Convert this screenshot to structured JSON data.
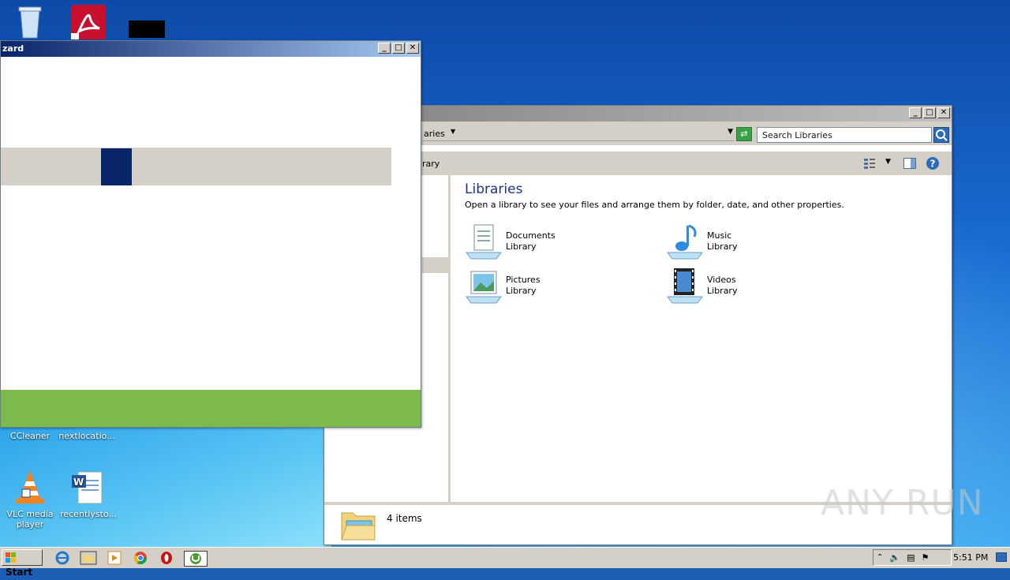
{
  "desktop": {
    "icons": [
      {
        "label": "",
        "icon": "recycle-bin-icon"
      },
      {
        "label": "",
        "icon": "acrobat-reader-icon"
      },
      {
        "label": "",
        "icon": "black-app-icon"
      },
      {
        "label": "CCleaner",
        "icon": "ccleaner-icon"
      },
      {
        "label": "nextlocatio...",
        "icon": "file-icon"
      },
      {
        "label": "VLC media player",
        "icon": "vlc-icon"
      },
      {
        "label": "recentlysto...",
        "icon": "word-document-icon"
      }
    ]
  },
  "wizard": {
    "title": "zard",
    "green_color": "#7dba4e"
  },
  "explorer": {
    "address": "aries",
    "search_placeholder": "Search Libraries",
    "toolbar_label": "rary",
    "heading": "Libraries",
    "description": "Open a library to see your files and arrange them by folder, date, and other properties.",
    "libraries": [
      {
        "name": "Documents",
        "type": "Library",
        "icon": "documents-library-icon"
      },
      {
        "name": "Music",
        "type": "Library",
        "icon": "music-library-icon"
      },
      {
        "name": "Pictures",
        "type": "Library",
        "icon": "pictures-library-icon"
      },
      {
        "name": "Videos",
        "type": "Library",
        "icon": "videos-library-icon"
      }
    ],
    "status": "4 items"
  },
  "taskbar": {
    "start_label": "Start",
    "clock": "5:51 PM",
    "apps": [
      "ie-icon",
      "explorer-icon",
      "media-player-icon",
      "chrome-icon",
      "opera-icon",
      "utorrent-icon"
    ]
  },
  "watermark": "ANY RUN"
}
